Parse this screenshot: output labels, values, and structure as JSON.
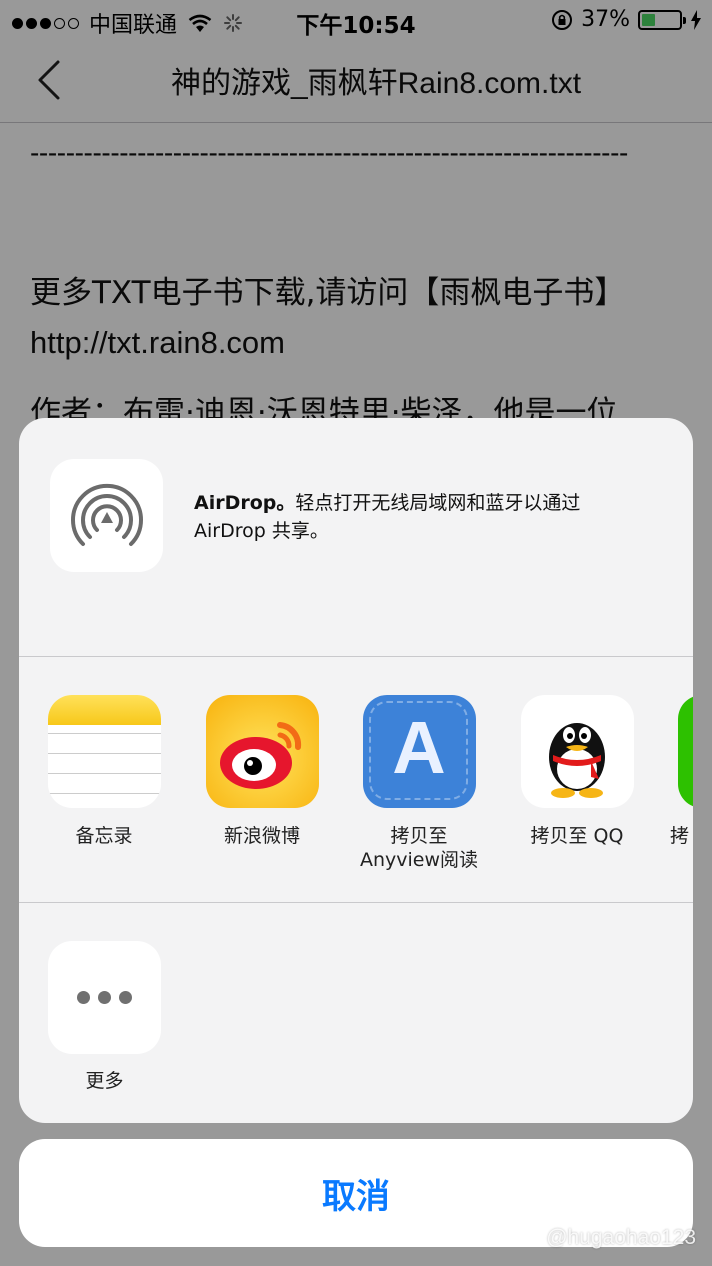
{
  "status_bar": {
    "carrier": "中国联通",
    "time": "下午10:54",
    "battery_percent_text": "37%",
    "battery_level": 0.37,
    "battery_color": "#4cd964",
    "icons": [
      "signal-dots-icon",
      "wifi-icon",
      "activity-spinner-icon",
      "orientation-lock-icon",
      "battery-icon",
      "charging-bolt-icon"
    ]
  },
  "nav": {
    "title": "神的游戏_雨枫轩Rain8.com.txt",
    "back_icon": "chevron-left-icon"
  },
  "document": {
    "dashes": "-------------------------------------------------------------------",
    "line1": "更多TXT电子书下载,请访问【雨枫电子书】",
    "line2": "http://txt.rain8.com",
    "line3": "作者：布雷·迪恩·沃恩特里·柴泽，他是一位"
  },
  "share_sheet": {
    "airdrop": {
      "icon": "airdrop-icon",
      "title": "AirDrop。",
      "text_rest": "轻点打开无线局域网和蓝牙以通过",
      "text_line2": "AirDrop 共享。"
    },
    "apps": [
      {
        "label": "备忘录",
        "icon": "notes-icon"
      },
      {
        "label": "新浪微博",
        "icon": "weibo-icon"
      },
      {
        "label": "拷贝至\nAnyview阅读",
        "label_line1": "拷贝至",
        "label_line2": "Anyview阅读",
        "icon": "anyview-icon"
      },
      {
        "label": "拷贝至 QQ",
        "icon": "qq-penguin-icon"
      },
      {
        "label": "拷",
        "icon": "wechat-icon"
      }
    ],
    "more": {
      "label": "更多",
      "icon": "more-dots-icon"
    }
  },
  "cancel_label": "取消",
  "accent_color": "#0a7aff",
  "watermark": "@hugaohao123"
}
